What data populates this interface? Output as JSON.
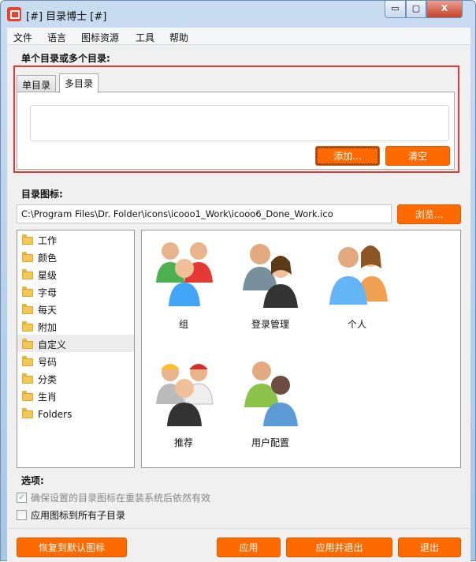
{
  "window": {
    "title": "[#] 目录博士 [#]",
    "minimize": "▭",
    "maximize": "▢",
    "close": "X"
  },
  "menu": [
    "文件",
    "语言",
    "图标资源",
    "工具",
    "帮助"
  ],
  "target_section": {
    "label": "单个目录或多个目录:",
    "tabs": [
      {
        "label": "单目录",
        "active": false
      },
      {
        "label": "多目录",
        "active": true
      }
    ],
    "add_button": "添加...",
    "clear_button": "清空"
  },
  "icon_section": {
    "label": "目录图标:",
    "path": "C:\\Program Files\\Dr. Folder\\icons\\icooo1_Work\\icooo6_Done_Work.ico",
    "browse_button": "浏览..."
  },
  "categories": [
    "工作",
    "颜色",
    "星级",
    "字母",
    "每天",
    "附加",
    "自定义",
    "号码",
    "分类",
    "生肖",
    "Folders"
  ],
  "selected_category": "自定义",
  "icon_items": [
    {
      "label": "组",
      "icon": "group-people-icon"
    },
    {
      "label": "登录管理",
      "icon": "login-management-icon"
    },
    {
      "label": "个人",
      "icon": "couple-icon"
    },
    {
      "label": "推荐",
      "icon": "workers-icon"
    },
    {
      "label": "用户配置",
      "icon": "user-config-icon"
    }
  ],
  "options": {
    "label": "选项:",
    "items": [
      {
        "label": "确保设置的目录图标在重装系统后依然有效",
        "checked": true,
        "disabled": true
      },
      {
        "label": "应用图标到所有子目录",
        "checked": false,
        "disabled": false
      }
    ]
  },
  "footer": {
    "restore": "恢复到默认图标",
    "apply": "应用",
    "apply_exit": "应用并退出",
    "exit": "退出"
  },
  "colors": {
    "accent": "#ff6a00",
    "highlight": "#e53935"
  }
}
